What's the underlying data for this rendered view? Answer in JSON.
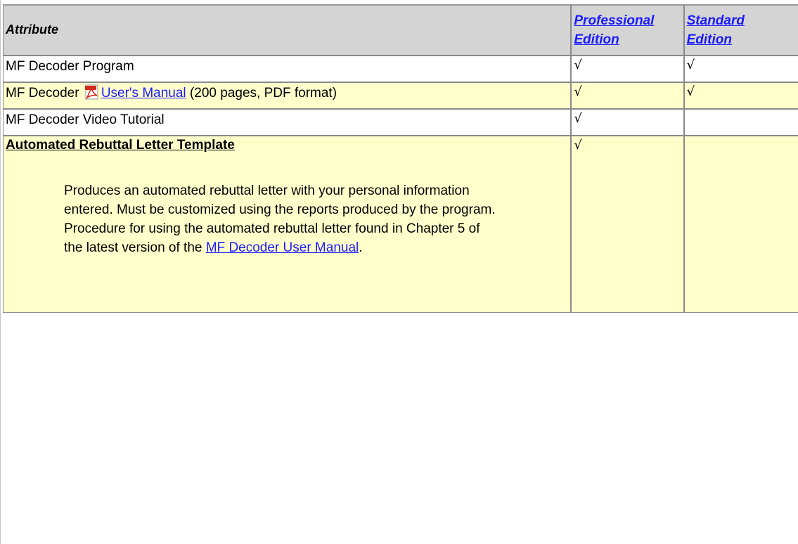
{
  "table": {
    "header": {
      "attribute": "Attribute",
      "professional_line1": "Professional",
      "professional_line2": "Edition",
      "standard_line1": "Standard",
      "standard_line2": "Edition"
    },
    "rows": [
      {
        "attribute": "MF Decoder Program",
        "professional": "√",
        "standard": "√"
      },
      {
        "attribute_prefix": "MF Decoder",
        "icon": "pdf-icon",
        "attribute_link": "User's Manual",
        "attribute_suffix": " (200 pages, PDF format)",
        "professional": "√",
        "standard": "√"
      },
      {
        "attribute": "MF Decoder Video Tutorial",
        "professional": "√",
        "standard": ""
      },
      {
        "title": "Automated Rebuttal Letter Template",
        "description_text": "Produces an automated rebuttal letter with your personal information entered.  Must be customized using the reports produced by the program.  Procedure for using the automated rebuttal letter found in Chapter 5 of the latest version of the ",
        "description_link": "MF Decoder User Manual",
        "description_end": ".",
        "professional": "√",
        "standard": ""
      }
    ]
  },
  "colors": {
    "header_bg": "#d4d4d4",
    "highlight_row_bg": "#ffffcc",
    "link": "#1a1aff"
  }
}
